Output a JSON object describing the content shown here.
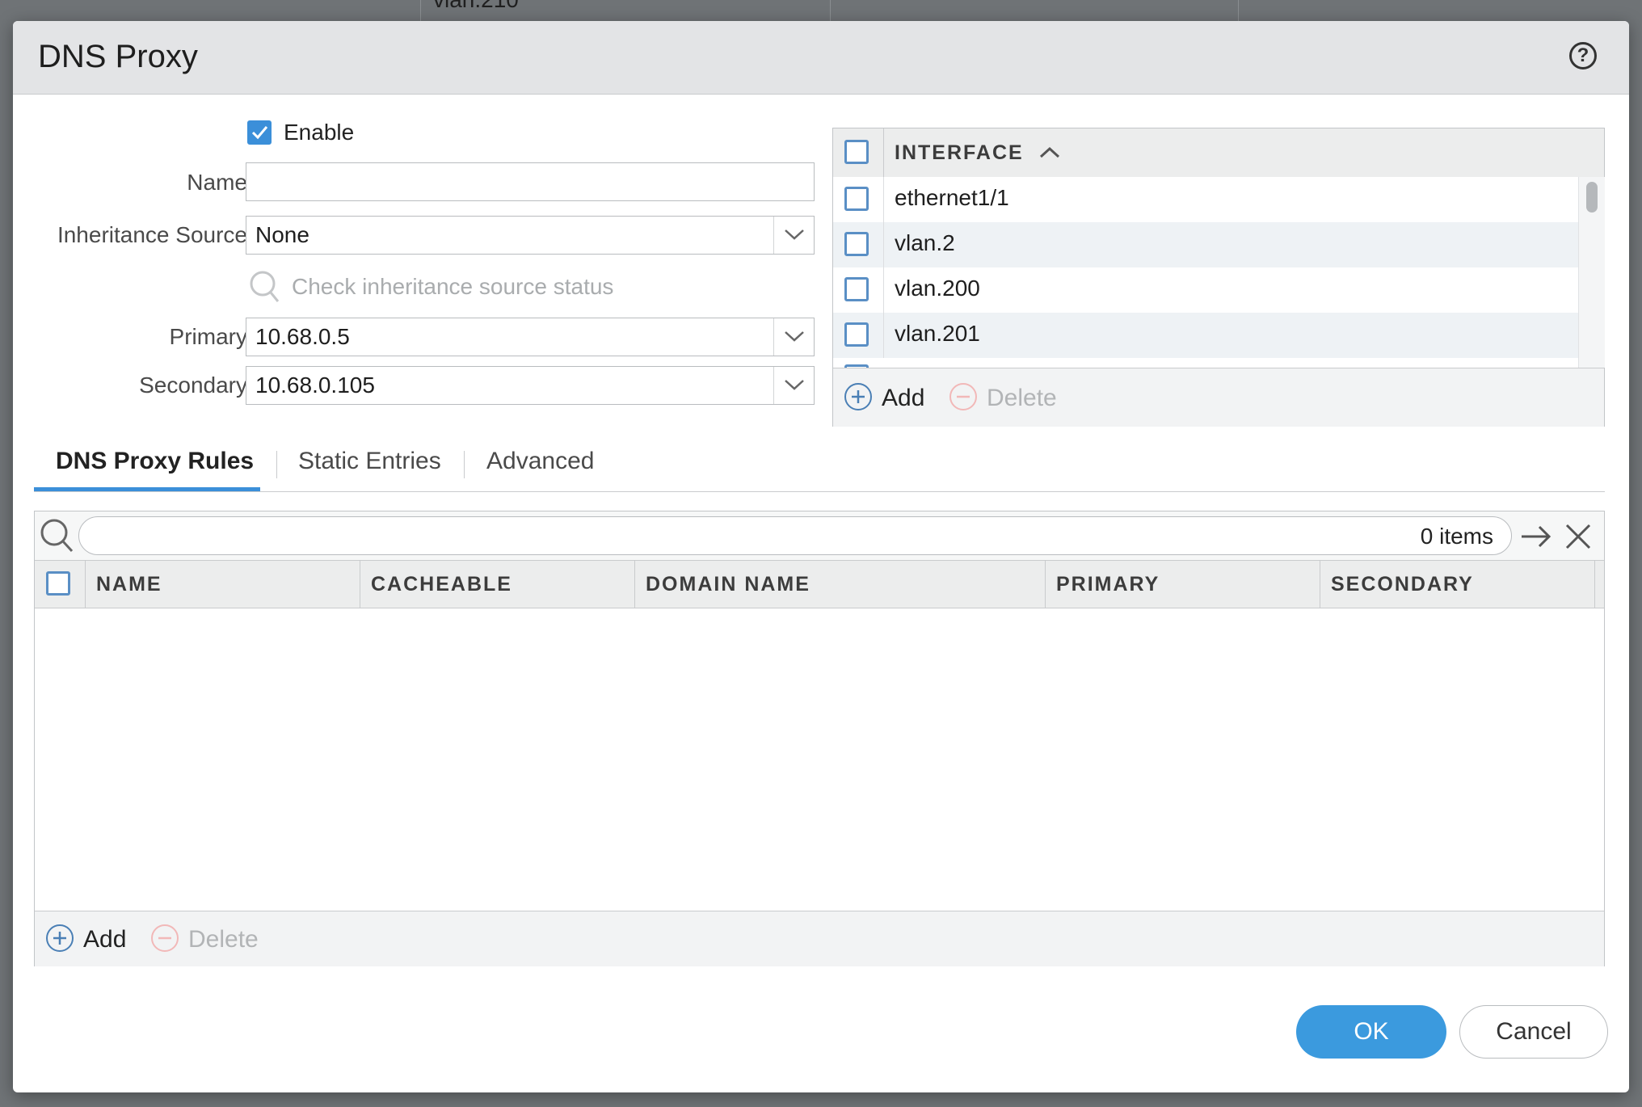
{
  "background": {
    "partial_text": "vlan.210"
  },
  "dialog": {
    "title": "DNS Proxy",
    "help_icon": "question-circle-icon"
  },
  "form": {
    "enable_label": "Enable",
    "enable_checked": true,
    "name_label": "Name",
    "name_value": "",
    "inheritance_label": "Inheritance Source",
    "inheritance_value": "None",
    "check_status_label": "Check inheritance source status",
    "primary_label": "Primary",
    "primary_value": "10.68.0.5",
    "secondary_label": "Secondary",
    "secondary_value": "10.68.0.105"
  },
  "interface_table": {
    "header": "INTERFACE",
    "rows": [
      {
        "name": "ethernet1/1"
      },
      {
        "name": "vlan.2"
      },
      {
        "name": "vlan.200"
      },
      {
        "name": "vlan.201"
      }
    ],
    "add_label": "Add",
    "delete_label": "Delete"
  },
  "tabs": [
    {
      "label": "DNS Proxy Rules",
      "active": true
    },
    {
      "label": "Static Entries",
      "active": false
    },
    {
      "label": "Advanced",
      "active": false
    }
  ],
  "rules_table": {
    "items_count": "0 items",
    "columns": [
      "NAME",
      "CACHEABLE",
      "DOMAIN NAME",
      "PRIMARY",
      "SECONDARY"
    ],
    "rows": [],
    "add_label": "Add",
    "delete_label": "Delete"
  },
  "buttons": {
    "ok": "OK",
    "cancel": "Cancel"
  },
  "colors": {
    "accent": "#3b8fd9",
    "ok_button": "#3b9ade",
    "header_bg": "#e3e4e6"
  }
}
